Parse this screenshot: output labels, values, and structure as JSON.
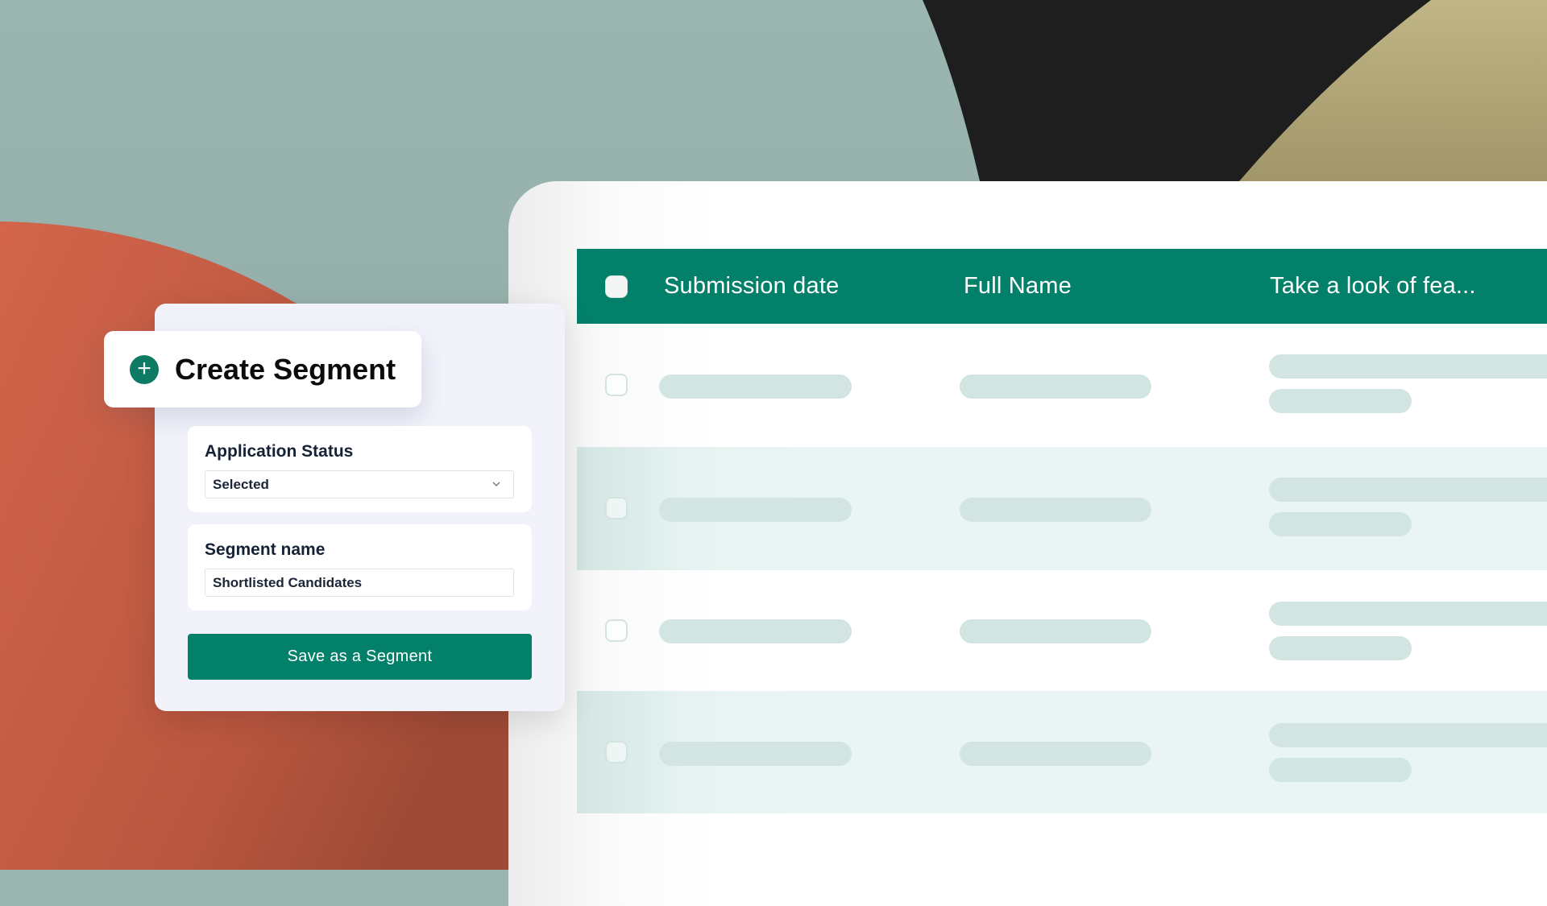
{
  "colors": {
    "background_sage": "#9bb5b0",
    "background_orange": "#d0634a",
    "background_black": "#1e1e1e",
    "background_khaki": "#bcb283",
    "brand_green": "#03806a",
    "skeleton": "#d2e5e2",
    "row_tint": "#e8f5f4",
    "panel_bg": "#f1f2fa"
  },
  "segment_panel": {
    "title": "Create Segment",
    "title_icon": "plus-circle-icon",
    "application_status": {
      "label": "Application Status",
      "value": "Selected",
      "icon": "chevron-down-icon"
    },
    "segment_name": {
      "label": "Segment name",
      "value": "Shortlisted Candidates"
    },
    "save_button_label": "Save as a Segment"
  },
  "table": {
    "columns": [
      {
        "label": "Submission date"
      },
      {
        "label": "Full Name"
      },
      {
        "label": "Take a look of fea..."
      }
    ],
    "rows": [
      {
        "state": "loading",
        "tinted": false
      },
      {
        "state": "loading",
        "tinted": true
      },
      {
        "state": "loading",
        "tinted": false
      },
      {
        "state": "loading",
        "tinted": true
      }
    ]
  }
}
